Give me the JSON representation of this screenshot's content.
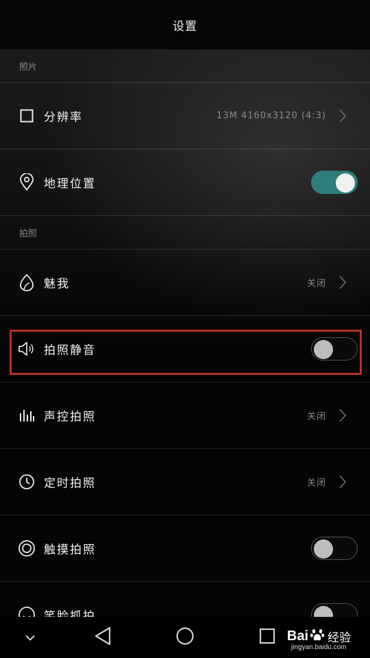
{
  "header": {
    "title": "设置"
  },
  "sections": {
    "photo": "照片",
    "shooting": "拍照"
  },
  "rows": {
    "resolution": {
      "label": "分辨率",
      "value": "13M  4160x3120  (4:3)",
      "icon": "square-icon"
    },
    "geo": {
      "label": "地理位置",
      "toggle": "on",
      "icon": "location-pin-icon"
    },
    "beauty": {
      "label": "魅我",
      "value": "关闭",
      "icon": "beauty-icon"
    },
    "mute": {
      "label": "拍照静音",
      "toggle": "off",
      "icon": "speaker-icon"
    },
    "voice": {
      "label": "声控拍照",
      "value": "关闭",
      "icon": "sound-bars-icon"
    },
    "timer": {
      "label": "定时拍照",
      "value": "关闭",
      "icon": "clock-icon"
    },
    "touch": {
      "label": "触摸拍照",
      "toggle": "off",
      "icon": "target-circle-icon"
    },
    "smile": {
      "label": "笑脸抓拍",
      "toggle": "off",
      "icon": "smile-icon"
    }
  },
  "colors": {
    "accent": "#2f7d7c",
    "highlight_border": "#b33226"
  },
  "watermark": {
    "brand_part1": "Bai",
    "brand_part2": "经验",
    "url": "jingyan.baidu.com"
  }
}
